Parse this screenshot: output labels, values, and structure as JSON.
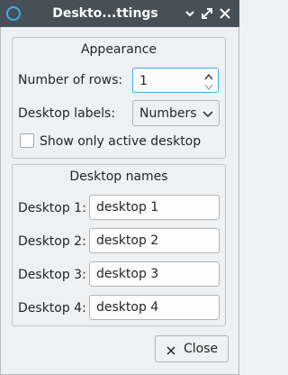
{
  "window": {
    "title": "Deskto...ttings"
  },
  "titlebar": {
    "icons": [
      "app-icon",
      "minimize-icon",
      "maximize-icon",
      "close-icon"
    ]
  },
  "appearance": {
    "group_title": "Appearance",
    "rows_label": "Number of rows:",
    "rows_value": "1",
    "labels_label": "Desktop labels:",
    "labels_value": "Numbers",
    "active_only_label": "Show only active desktop",
    "active_only_checked": false
  },
  "desktop_names": {
    "group_title": "Desktop names",
    "items": [
      {
        "label": "Desktop 1:",
        "value": "desktop 1"
      },
      {
        "label": "Desktop 2:",
        "value": "desktop 2"
      },
      {
        "label": "Desktop 3:",
        "value": "desktop 3"
      },
      {
        "label": "Desktop 4:",
        "value": "desktop 4"
      }
    ]
  },
  "footer": {
    "close_label": "Close"
  },
  "colors": {
    "titlebar_bg": "#475057",
    "window_bg": "#eff0f1",
    "focus_accent": "#3daee9",
    "text": "#232627"
  }
}
